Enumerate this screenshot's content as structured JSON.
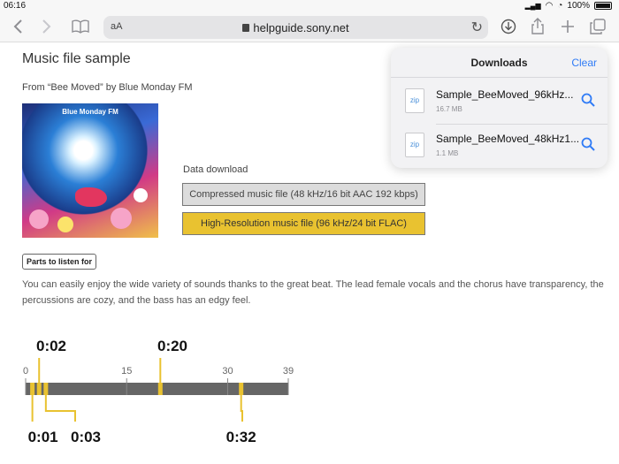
{
  "statusbar": {
    "time": "06:16",
    "battery": "100%"
  },
  "browser": {
    "text_size_label": "aA",
    "url": "helpguide.sony.net",
    "icons": [
      "back-icon",
      "forward-icon",
      "bookmarks-icon",
      "reload-icon",
      "downloads-icon",
      "share-icon",
      "new-tab-icon",
      "tabs-icon"
    ]
  },
  "page": {
    "title": "Music file sample",
    "from": "From “Bee Moved” by Blue Monday FM",
    "album_label": "Blue Monday FM",
    "data_download_label": "Data download",
    "compressed_button": "Compressed music file (48 kHz/16 bit AAC 192 kbps)",
    "hires_button": "High-Resolution music file (96 kHz/24 bit FLAC)",
    "parts_button": "Parts to listen for",
    "description": "You can easily enjoy the wide variety of sounds thanks to the great beat. The lead female vocals and the chorus have transparency, the percussions are cozy, and the bass has an edgy feel."
  },
  "timeline": {
    "max_seconds": 39,
    "ticks": [
      {
        "label": "0",
        "value": 0
      },
      {
        "label": "15",
        "value": 15
      },
      {
        "label": "30",
        "value": 30
      },
      {
        "label": "39",
        "value": 39
      }
    ],
    "markers": [
      {
        "label": "0:01",
        "value": 1,
        "side": "below"
      },
      {
        "label": "0:02",
        "value": 2,
        "side": "above"
      },
      {
        "label": "0:03",
        "value": 3,
        "side": "below"
      },
      {
        "label": "0:20",
        "value": 20,
        "side": "above"
      },
      {
        "label": "0:32",
        "value": 32,
        "side": "below"
      }
    ],
    "colors": {
      "bar": "#666666",
      "marker": "#e9c230"
    }
  },
  "downloads": {
    "title": "Downloads",
    "clear_label": "Clear",
    "items": [
      {
        "type_label": "zip",
        "name": "Sample_BeeMoved_96kHz...",
        "size": "16.7 MB"
      },
      {
        "type_label": "zip",
        "name": "Sample_BeeMoved_48kHz1...",
        "size": "1.1 MB"
      }
    ]
  },
  "colors": {
    "accent": "#2f7bf6",
    "hires_button": "#e9c230",
    "compressed_button": "#dcdcdc"
  }
}
